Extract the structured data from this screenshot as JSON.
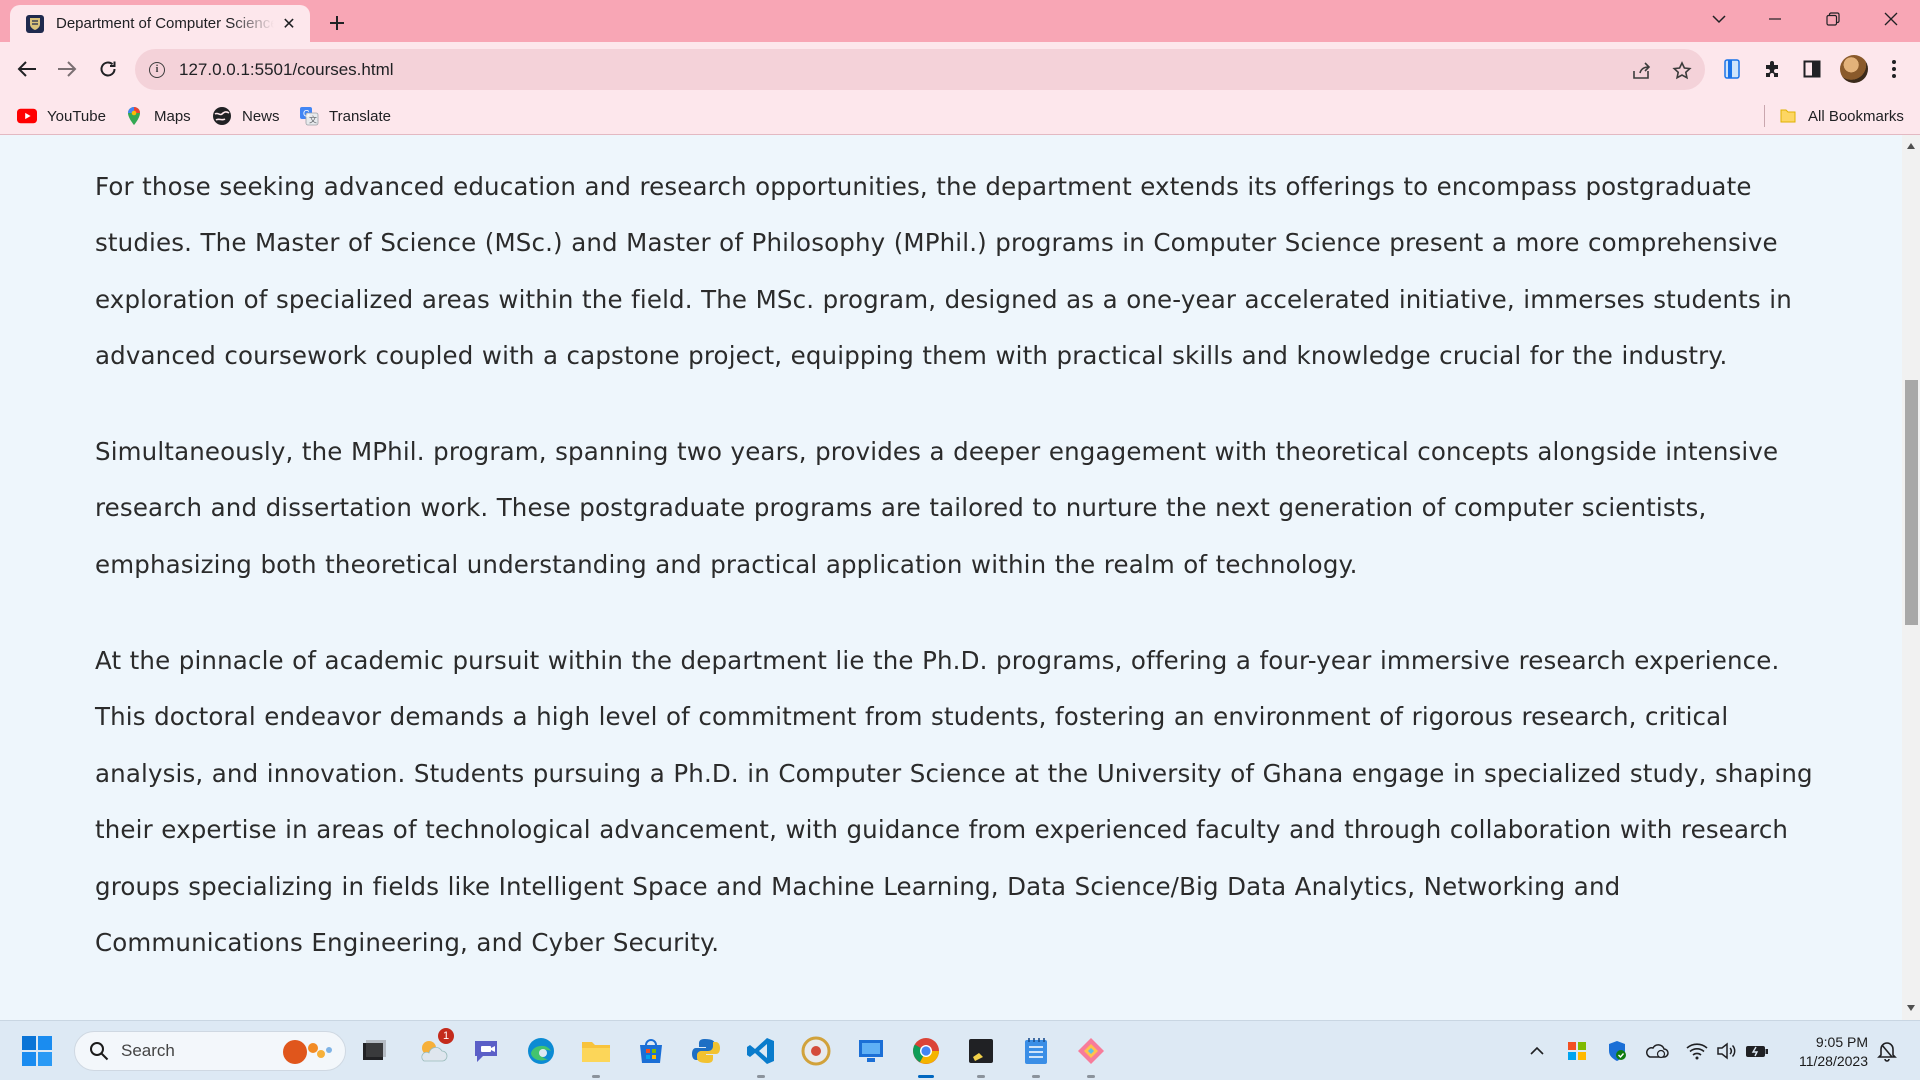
{
  "browser": {
    "tab": {
      "title": "Department of Computer Science",
      "close_glyph": "✕"
    },
    "new_tab_glyph": "+",
    "address_bar": {
      "url": "127.0.0.1:5501/courses.html",
      "security_glyph": "i"
    },
    "bookmarks": [
      {
        "label": "YouTube",
        "icon": "youtube-icon"
      },
      {
        "label": "Maps",
        "icon": "maps-icon"
      },
      {
        "label": "News",
        "icon": "news-icon"
      },
      {
        "label": "Translate",
        "icon": "translate-icon"
      }
    ],
    "all_bookmarks_label": "All Bookmarks"
  },
  "page": {
    "paragraphs": [
      "For those seeking advanced education and research opportunities, the department extends its offerings to encompass postgraduate studies. The Master of Science (MSc.) and Master of Philosophy (MPhil.) programs in Computer Science present a more comprehensive exploration of specialized areas within the field. The MSc. program, designed as a one-year accelerated initiative, immerses students in advanced coursework coupled with a capstone project, equipping them with practical skills and knowledge crucial for the industry.",
      "Simultaneously, the MPhil. program, spanning two years, provides a deeper engagement with theoretical concepts alongside intensive research and dissertation work. These postgraduate programs are tailored to nurture the next generation of computer scientists, emphasizing both theoretical understanding and practical application within the realm of technology.",
      "At the pinnacle of academic pursuit within the department lie the Ph.D. programs, offering a four-year immersive research experience. This doctoral endeavor demands a high level of commitment from students, fostering an environment of rigorous research, critical analysis, and innovation. Students pursuing a Ph.D. in Computer Science at the University of Ghana engage in specialized study, shaping their expertise in areas of technological advancement, with guidance from experienced faculty and through collaboration with research groups specializing in fields like Intelligent Space and Machine Learning, Data Science/Big Data Analytics, Networking and Communications Engineering, and Cyber Security."
    ]
  },
  "taskbar": {
    "search_placeholder": "Search",
    "notification_count": "1",
    "clock": {
      "time": "9:05 PM",
      "date": "11/28/2023"
    }
  },
  "colors": {
    "titlebar": "#f8a6b5",
    "toolbar": "#fde7ec",
    "page_background": "#eef6fc",
    "body_text": "#2b2b2b",
    "taskbar": "#dde9f4"
  }
}
